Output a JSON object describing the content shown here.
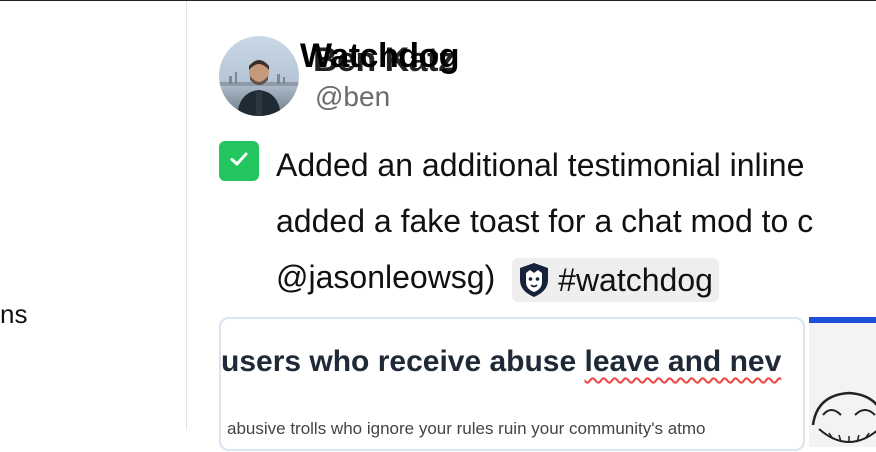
{
  "sidebar": {
    "fragment_text": "ns"
  },
  "post": {
    "author_name": "Ben Katz",
    "project_name": "Watchdog",
    "handle": "@ben",
    "lines": [
      "Added an additional testimonial inline",
      "added a fake toast for a chat mod to c",
      "@jasonleowsg)"
    ],
    "tag": "#watchdog",
    "check_color": "#22c55e"
  },
  "attachment": {
    "headline_prefix": "users who receive abuse ",
    "headline_squiggle": "leave and nev",
    "body": "abusive trolls who ignore your rules ruin your community's atmo"
  },
  "icons": {
    "check": "checkmark-icon",
    "tag": "watchdog-logo-icon",
    "avatar": "user-avatar"
  }
}
